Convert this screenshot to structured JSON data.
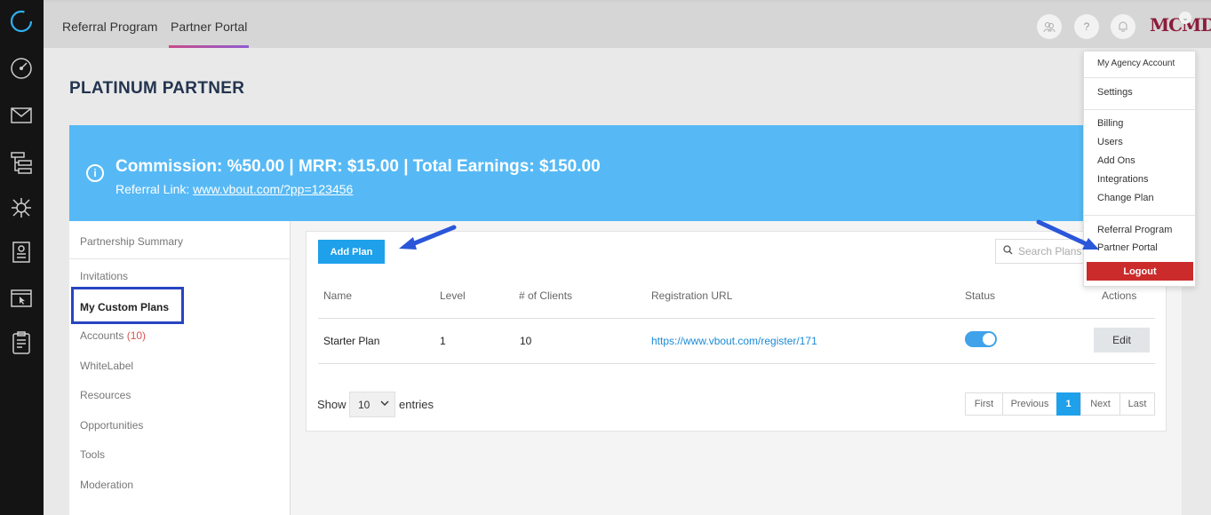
{
  "topnav": {
    "tabs": [
      {
        "label": "Referral Program"
      },
      {
        "label": "Partner Portal"
      }
    ],
    "icons": [
      "partners-icon",
      "help-icon",
      "notifications-icon"
    ],
    "help_glyph": "?",
    "logo_text": "MCMD"
  },
  "page": {
    "title": "PLATINUM PARTNER"
  },
  "banner": {
    "headline": "Commission: %50.00 | MRR: $15.00 | Total Earnings: $150.00",
    "referral_label": "Referral Link:",
    "referral_url": "www.vbout.com/?pp=123456",
    "color": "#56b9f5"
  },
  "sidebar": {
    "items": [
      {
        "label": "Partnership Summary"
      },
      {
        "label": "Invitations"
      },
      {
        "label": "My Custom Plans"
      },
      {
        "label": "Accounts",
        "badge": "(10)"
      },
      {
        "label": "WhiteLabel"
      },
      {
        "label": "Resources"
      },
      {
        "label": "Opportunities"
      },
      {
        "label": "Tools"
      },
      {
        "label": "Moderation"
      }
    ]
  },
  "toolbar": {
    "add_plan_label": "Add Plan",
    "search_placeholder": "Search Plans"
  },
  "table": {
    "headers": [
      "Name",
      "Level",
      "# of Clients",
      "Registration URL",
      "Status",
      "Actions"
    ],
    "rows": [
      {
        "name": "Starter Plan",
        "level": "1",
        "clients": "10",
        "url": "https://www.vbout.com/register/171",
        "status_on": true,
        "action": "Edit"
      }
    ]
  },
  "length_menu": {
    "show_label": "Show",
    "selected": "10",
    "entries_label": "entries"
  },
  "pagination": {
    "first": "First",
    "previous": "Previous",
    "current": "1",
    "next": "Next",
    "last": "Last"
  },
  "account_menu": {
    "header": "My Agency Account",
    "settings": "Settings",
    "group1": [
      "Billing",
      "Users",
      "Add Ons",
      "Integrations",
      "Change Plan"
    ],
    "group2": [
      "Referral Program",
      "Partner Portal"
    ],
    "logout": "Logout"
  },
  "colors": {
    "accent": "#1fa0ea",
    "logout": "#cc2b2b",
    "highlight": "#2744c2"
  }
}
